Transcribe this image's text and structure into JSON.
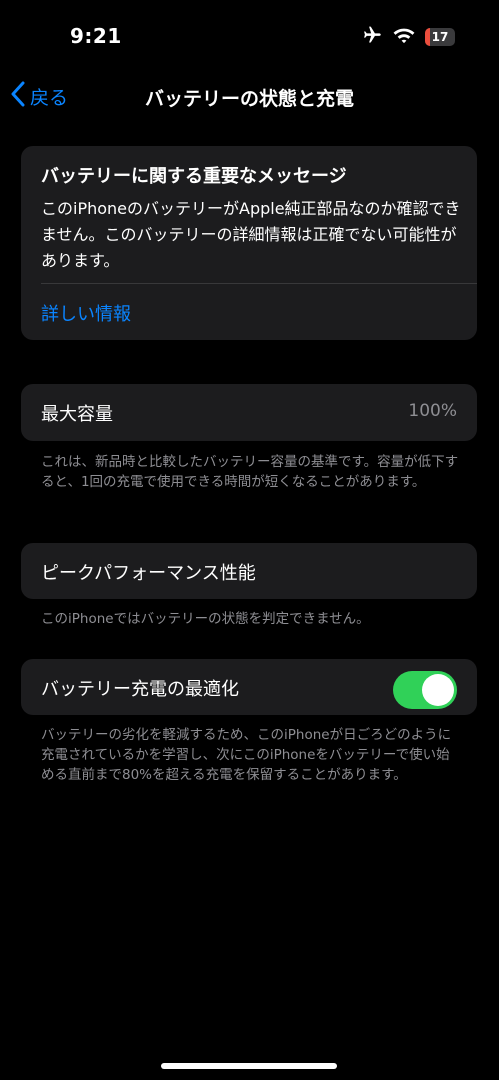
{
  "status_bar": {
    "time": "9:21",
    "battery_level": "17",
    "battery_fraction": 0.17,
    "icons": [
      "airplane-icon",
      "wifi-icon",
      "battery-icon"
    ]
  },
  "nav": {
    "back_label": "戻る",
    "title": "バッテリーの状態と充電"
  },
  "message_card": {
    "title": "バッテリーに関する重要なメッセージ",
    "body": "このiPhoneのバッテリーがApple純正部品なのか確認できません。このバッテリーの詳細情報は正確でない可能性があります。",
    "link": "詳しい情報"
  },
  "max_capacity": {
    "label": "最大容量",
    "value": "100%",
    "footnote": "これは、新品時と比較したバッテリー容量の基準です。容量が低下すると、1回の充電で使用できる時間が短くなることがあります。"
  },
  "peak_performance": {
    "label": "ピークパフォーマンス性能",
    "footnote": "このiPhoneではバッテリーの状態を判定できません。"
  },
  "optimized_charging": {
    "label": "バッテリー充電の最適化",
    "enabled": true,
    "footnote": "バッテリーの劣化を軽減するため、このiPhoneが日ごろどのように充電されているかを学習し、次にこのiPhoneをバッテリーで使い始める直前まで80%を超える充電を保留することがあります。"
  },
  "colors": {
    "background": "#000000",
    "card": "#1c1c1e",
    "accent": "#0a84ff",
    "toggle_on": "#30d158",
    "secondary_text": "#8e8e93",
    "battery_low": "#eb4e3d"
  }
}
